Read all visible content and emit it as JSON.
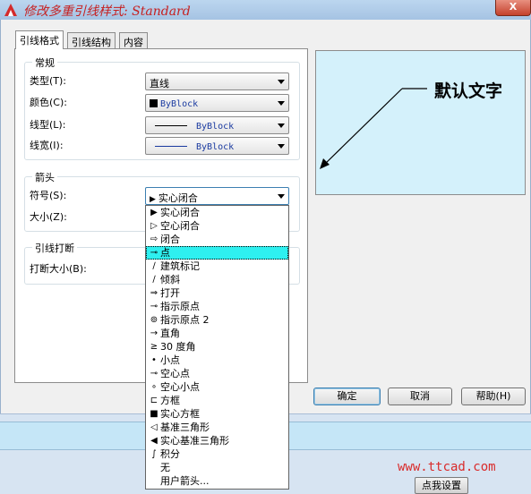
{
  "window": {
    "title": "修改多重引线样式: Standard",
    "close_label": "X"
  },
  "tabs": [
    {
      "label": "引线格式",
      "active": true
    },
    {
      "label": "引线结构",
      "active": false
    },
    {
      "label": "内容",
      "active": false
    }
  ],
  "general": {
    "title": "常规",
    "type_label": "类型(T):",
    "type_value": "直线",
    "color_label": "颜色(C):",
    "color_value": "ByBlock",
    "linetype_label": "线型(L):",
    "linetype_value": "ByBlock",
    "lineweight_label": "线宽(I):",
    "lineweight_value": "ByBlock"
  },
  "arrowhead": {
    "title": "箭头",
    "symbol_label": "符号(S):",
    "symbol_value": "实心闭合",
    "size_label": "大小(Z):"
  },
  "leader_break": {
    "title": "引线打断",
    "break_size_label": "打断大小(B):"
  },
  "dropdown": {
    "selected_index": 3,
    "items": [
      {
        "label": "实心闭合",
        "icon": "solid-closed-arrow-icon",
        "glyph": "▶"
      },
      {
        "label": "空心闭合",
        "icon": "hollow-closed-arrow-icon",
        "glyph": "▷"
      },
      {
        "label": "闭合",
        "icon": "closed-arrow-icon",
        "glyph": "⇨"
      },
      {
        "label": "点",
        "icon": "dot-icon",
        "glyph": "⊸"
      },
      {
        "label": "建筑标记",
        "icon": "architectural-tick-icon",
        "glyph": "∕"
      },
      {
        "label": "倾斜",
        "icon": "oblique-icon",
        "glyph": "∕"
      },
      {
        "label": "打开",
        "icon": "open-arrow-icon",
        "glyph": "⇒"
      },
      {
        "label": "指示原点",
        "icon": "origin-indicator-icon",
        "glyph": "⊸"
      },
      {
        "label": "指示原点 2",
        "icon": "origin-indicator-2-icon",
        "glyph": "⊚"
      },
      {
        "label": "直角",
        "icon": "right-angle-icon",
        "glyph": "→"
      },
      {
        "label": "30 度角",
        "icon": "open-30-icon",
        "glyph": "≥"
      },
      {
        "label": "小点",
        "icon": "dot-small-icon",
        "glyph": "•"
      },
      {
        "label": "空心点",
        "icon": "dot-blank-icon",
        "glyph": "⊸"
      },
      {
        "label": "空心小点",
        "icon": "dot-small-blank-icon",
        "glyph": "∘"
      },
      {
        "label": "方框",
        "icon": "box-blank-icon",
        "glyph": "⊏"
      },
      {
        "label": "实心方框",
        "icon": "box-filled-icon",
        "glyph": "■"
      },
      {
        "label": "基准三角形",
        "icon": "datum-triangle-icon",
        "glyph": "◁"
      },
      {
        "label": "实心基准三角形",
        "icon": "datum-triangle-filled-icon",
        "glyph": "◀"
      },
      {
        "label": "积分",
        "icon": "integral-icon",
        "glyph": "∫"
      },
      {
        "label": "无",
        "icon": "none-icon",
        "glyph": ""
      },
      {
        "label": "用户箭头...",
        "icon": "user-arrow-icon",
        "glyph": ""
      }
    ]
  },
  "preview": {
    "text": "默认文字"
  },
  "buttons": {
    "ok": "确定",
    "cancel": "取消",
    "help": "帮助(H)"
  },
  "watermark": "www.ttcad.com",
  "setup_button": "点我设置",
  "colors": {
    "title_text": "#c62020",
    "selection": "#2ef0f0",
    "preview_bg": "#d4f1fb"
  }
}
